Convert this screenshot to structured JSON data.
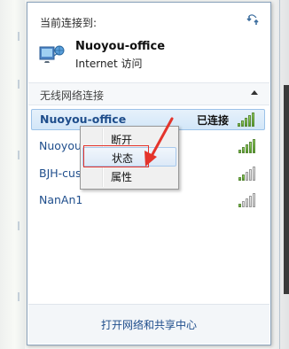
{
  "popup": {
    "current_connection_label": "当前连接到:",
    "network": {
      "name": "Nuoyou-office",
      "status": "Internet 访问"
    },
    "section": {
      "label": "无线网络连接"
    },
    "wifi_list": [
      {
        "name": "Nuoyou-office",
        "state": "已连接",
        "signal": 5
      },
      {
        "name": "Nuoyou",
        "state": "",
        "signal": 5
      },
      {
        "name": "BJH-cus",
        "state": "",
        "signal": 2
      },
      {
        "name": "NanAn1",
        "state": "",
        "signal": 1
      }
    ],
    "footer_link": "打开网络和共享中心"
  },
  "context_menu": {
    "items": [
      "断开",
      "状态",
      "属性"
    ],
    "highlighted": "状态"
  },
  "annotation_color": "#e4342c"
}
